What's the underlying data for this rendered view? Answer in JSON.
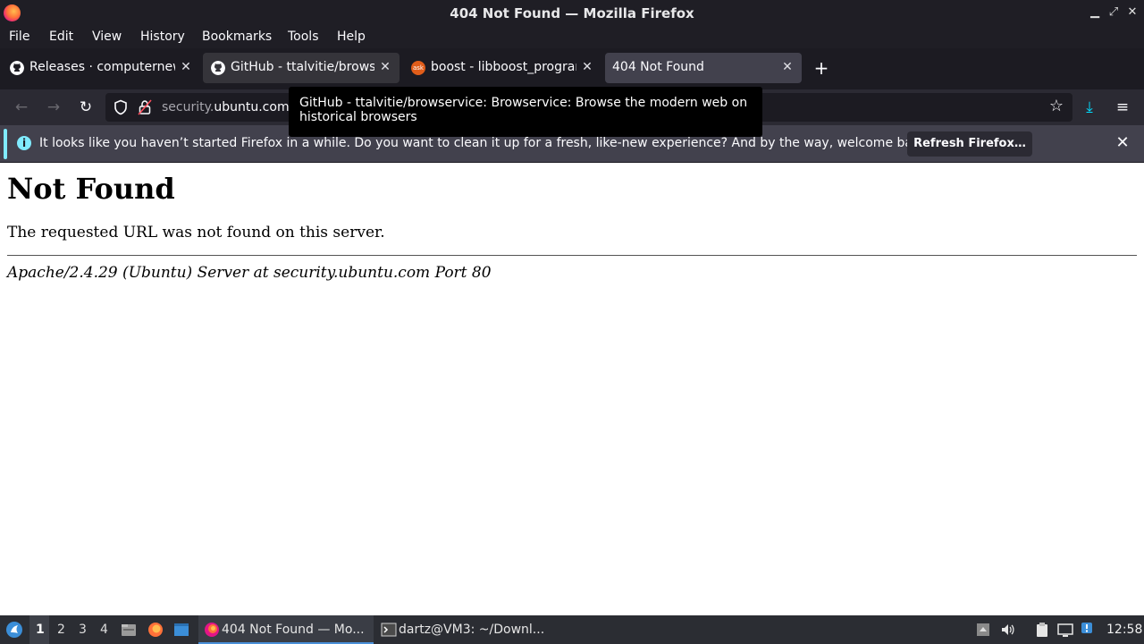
{
  "window": {
    "title": "404 Not Found — Mozilla Firefox",
    "controls": [
      "minimize-icon",
      "maximize-icon",
      "close-icon"
    ]
  },
  "menubar": {
    "items": [
      "File",
      "Edit",
      "View",
      "History",
      "Bookmarks",
      "Tools",
      "Help"
    ]
  },
  "tabs": [
    {
      "label": "Releases · computernewb",
      "icon": "github-icon",
      "state": "normal"
    },
    {
      "label": "GitHub - ttalvitie/browse",
      "icon": "github-icon",
      "state": "hover"
    },
    {
      "label": "boost - libboost_program",
      "icon": "askubuntu-icon",
      "state": "normal"
    },
    {
      "label": "404 Not Found",
      "icon": "",
      "state": "selected"
    }
  ],
  "new_tab_symbol": "+",
  "urlbar": {
    "url_prefix": "security.",
    "url_domain": "ubuntu.com"
  },
  "tooltip": {
    "text": "GitHub - ttalvitie/browservice: Browservice: Browse the modern web on historical browsers"
  },
  "infobar": {
    "message": "It looks like you haven’t started Firefox in a while. Do you want to clean it up for a fresh, like-new experience? And by the way, welcome back!",
    "button_label": "Refresh Firefox…",
    "accent_color": "#80ebff"
  },
  "page": {
    "heading": "Not Found",
    "paragraph": "The requested URL was not found on this server.",
    "address": "Apache/2.4.29 (Ubuntu) Server at security.ubuntu.com Port 80"
  },
  "taskbar": {
    "workspaces": [
      "1",
      "2",
      "3",
      "4"
    ],
    "active_workspace": "1",
    "tasks": [
      {
        "label": "404 Not Found — Mo...",
        "icon": "firefox-icon",
        "active": true
      },
      {
        "label": "dartz@VM3: ~/Downl...",
        "icon": "terminal-icon",
        "active": false
      }
    ],
    "clock": "12:58"
  }
}
